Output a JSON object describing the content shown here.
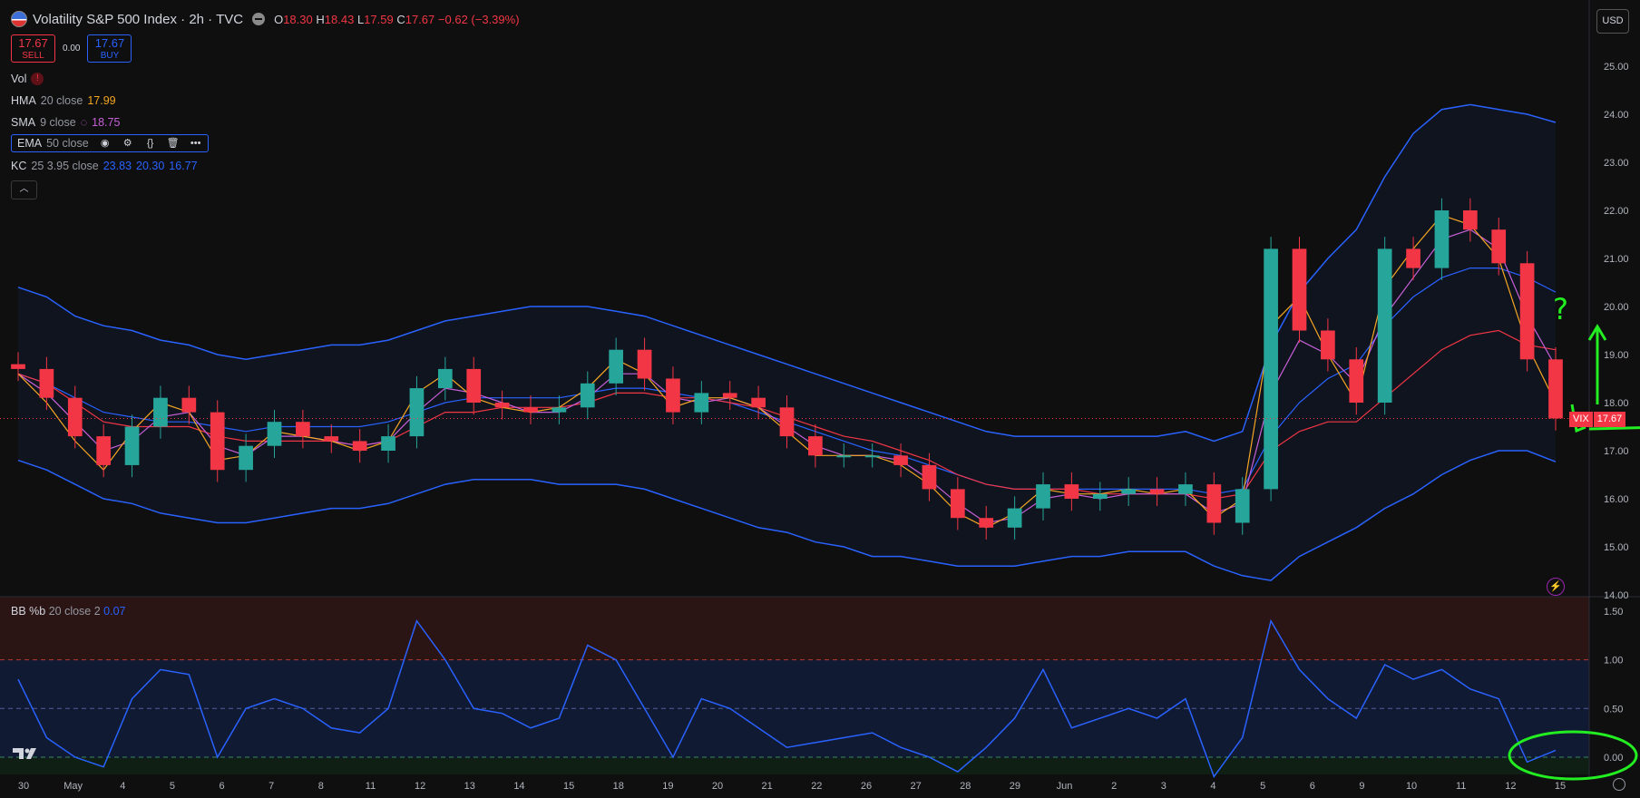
{
  "header": {
    "symbol": "Volatility S&P 500 Index · 2h · TVC",
    "open_label": "O",
    "open": "18.30",
    "high_label": "H",
    "high": "18.43",
    "low_label": "L",
    "low": "17.59",
    "close_label": "C",
    "close": "17.67",
    "change": "−0.62 (−3.39%)"
  },
  "trade": {
    "sell_price": "17.67",
    "sell_label": "SELL",
    "spread": "0.00",
    "buy_price": "17.67",
    "buy_label": "BUY"
  },
  "indicators": {
    "vol": "Vol",
    "hma": {
      "name": "HMA",
      "params": "20 close",
      "value": "17.99"
    },
    "sma": {
      "name": "SMA",
      "params": "9 close",
      "value": "18.75"
    },
    "ema": {
      "name": "EMA",
      "params": "50 close"
    },
    "kc": {
      "name": "KC",
      "params": "25 3.95 close",
      "v1": "23.83",
      "v2": "20.30",
      "v3": "16.77"
    }
  },
  "currency": "USD",
  "price_label": {
    "ticker": "VIX",
    "value": "17.67"
  },
  "bb": {
    "name": "BB %b",
    "params": "20 close 2",
    "value": "0.07"
  },
  "colors": {
    "up": "#26a69a",
    "down": "#f23645",
    "hma": "#f5a623",
    "sma": "#c760d8",
    "ema": "#f23645",
    "kc": "#2962ff",
    "bb": "#2962ff",
    "annotation": "#22ee22"
  },
  "chart_data": {
    "type": "candlestick",
    "y_axis_price": [
      "25.00",
      "24.00",
      "23.00",
      "22.00",
      "21.00",
      "20.00",
      "19.00",
      "18.00",
      "17.00",
      "16.00",
      "15.00",
      "14.00"
    ],
    "y_axis_bb": [
      "1.50",
      "1.00",
      "0.50",
      "0.00"
    ],
    "x_axis": [
      "30",
      "May",
      "4",
      "5",
      "6",
      "7",
      "8",
      "11",
      "12",
      "13",
      "14",
      "15",
      "18",
      "19",
      "20",
      "21",
      "22",
      "26",
      "27",
      "28",
      "29",
      "Jun",
      "2",
      "3",
      "4",
      "5",
      "6",
      "9",
      "10",
      "11",
      "12",
      "15"
    ],
    "closes": [
      18.7,
      18.1,
      17.3,
      16.7,
      17.5,
      18.1,
      17.8,
      16.6,
      17.1,
      17.6,
      17.3,
      17.2,
      17.0,
      17.3,
      18.3,
      18.7,
      18.0,
      17.9,
      17.8,
      17.9,
      18.4,
      19.1,
      18.5,
      17.8,
      18.2,
      18.1,
      17.9,
      17.3,
      16.9,
      16.9,
      16.9,
      16.7,
      16.2,
      15.6,
      15.4,
      15.8,
      16.3,
      16.0,
      16.1,
      16.2,
      16.1,
      16.3,
      15.5,
      16.2,
      21.2,
      19.5,
      18.9,
      18.0,
      21.2,
      20.8,
      22.0,
      21.6,
      20.9,
      18.9,
      17.67
    ],
    "hma": [
      18.6,
      18.0,
      17.2,
      16.6,
      17.4,
      18.0,
      17.8,
      16.8,
      16.9,
      17.4,
      17.3,
      17.2,
      17.0,
      17.2,
      18.2,
      18.6,
      18.1,
      17.9,
      17.8,
      17.9,
      18.3,
      18.9,
      18.6,
      17.9,
      18.1,
      18.1,
      17.9,
      17.4,
      16.9,
      16.9,
      16.9,
      16.7,
      16.3,
      15.7,
      15.4,
      15.7,
      16.2,
      16.1,
      16.1,
      16.2,
      16.1,
      16.2,
      15.6,
      16.0,
      19.6,
      20.2,
      19.0,
      18.0,
      20.4,
      21.2,
      21.9,
      21.7,
      21.0,
      19.2,
      17.99
    ],
    "sma": [
      18.6,
      18.2,
      17.6,
      17.0,
      17.2,
      17.7,
      17.8,
      17.1,
      16.9,
      17.3,
      17.3,
      17.2,
      17.1,
      17.2,
      17.8,
      18.3,
      18.2,
      18.0,
      17.8,
      17.8,
      18.1,
      18.6,
      18.6,
      18.1,
      18.0,
      18.1,
      17.9,
      17.5,
      17.1,
      16.9,
      16.9,
      16.8,
      16.4,
      15.9,
      15.5,
      15.6,
      16.0,
      16.1,
      16.0,
      16.1,
      16.1,
      16.1,
      15.7,
      15.9,
      18.2,
      19.3,
      19.0,
      18.4,
      19.8,
      20.6,
      21.4,
      21.6,
      21.2,
      19.8,
      18.75
    ],
    "ema": [
      18.6,
      18.4,
      18.0,
      17.6,
      17.5,
      17.5,
      17.5,
      17.3,
      17.2,
      17.2,
      17.2,
      17.2,
      17.1,
      17.2,
      17.5,
      17.8,
      17.8,
      17.9,
      17.9,
      17.9,
      18.0,
      18.2,
      18.2,
      18.1,
      18.1,
      18.0,
      17.9,
      17.7,
      17.5,
      17.3,
      17.2,
      17.0,
      16.8,
      16.5,
      16.3,
      16.2,
      16.2,
      16.2,
      16.1,
      16.1,
      16.1,
      16.1,
      16.0,
      16.1,
      17.0,
      17.4,
      17.6,
      17.6,
      18.1,
      18.6,
      19.1,
      19.4,
      19.5,
      19.2,
      19.1
    ],
    "kc_upper": [
      20.4,
      20.2,
      19.8,
      19.6,
      19.5,
      19.3,
      19.2,
      19.0,
      18.9,
      19.0,
      19.1,
      19.2,
      19.2,
      19.3,
      19.5,
      19.7,
      19.8,
      19.9,
      20.0,
      20.0,
      20.0,
      19.9,
      19.8,
      19.6,
      19.4,
      19.2,
      19.0,
      18.8,
      18.6,
      18.4,
      18.2,
      18.0,
      17.8,
      17.6,
      17.4,
      17.3,
      17.3,
      17.3,
      17.3,
      17.3,
      17.3,
      17.4,
      17.2,
      17.4,
      19.2,
      20.3,
      21.0,
      21.6,
      22.7,
      23.6,
      24.1,
      24.2,
      24.1,
      24.0,
      23.83
    ],
    "kc_mid": [
      18.6,
      18.4,
      18.1,
      17.8,
      17.7,
      17.6,
      17.6,
      17.5,
      17.4,
      17.5,
      17.5,
      17.5,
      17.5,
      17.6,
      17.8,
      18.0,
      18.1,
      18.1,
      18.1,
      18.1,
      18.2,
      18.3,
      18.3,
      18.2,
      18.1,
      18.0,
      17.8,
      17.6,
      17.4,
      17.2,
      17.0,
      16.9,
      16.7,
      16.5,
      16.3,
      16.2,
      16.2,
      16.2,
      16.2,
      16.2,
      16.2,
      16.2,
      16.1,
      16.2,
      17.3,
      18.0,
      18.5,
      18.8,
      19.6,
      20.2,
      20.6,
      20.8,
      20.8,
      20.6,
      20.3
    ],
    "kc_lower": [
      16.8,
      16.6,
      16.3,
      16.0,
      15.9,
      15.7,
      15.6,
      15.5,
      15.5,
      15.6,
      15.7,
      15.8,
      15.8,
      15.9,
      16.1,
      16.3,
      16.4,
      16.4,
      16.4,
      16.3,
      16.3,
      16.3,
      16.2,
      16.0,
      15.8,
      15.6,
      15.4,
      15.3,
      15.1,
      15.0,
      14.8,
      14.8,
      14.7,
      14.6,
      14.6,
      14.6,
      14.7,
      14.8,
      14.8,
      14.9,
      14.9,
      14.9,
      14.6,
      14.4,
      14.3,
      14.8,
      15.1,
      15.4,
      15.8,
      16.1,
      16.5,
      16.8,
      17.0,
      17.0,
      16.77
    ],
    "bb_pct_b": [
      0.8,
      0.2,
      0.0,
      -0.1,
      0.6,
      0.9,
      0.85,
      0.0,
      0.5,
      0.6,
      0.5,
      0.3,
      0.25,
      0.5,
      1.4,
      1.0,
      0.5,
      0.45,
      0.3,
      0.4,
      1.15,
      1.0,
      0.5,
      0.0,
      0.6,
      0.5,
      0.3,
      0.1,
      0.15,
      0.2,
      0.25,
      0.1,
      0.0,
      -0.15,
      0.1,
      0.4,
      0.9,
      0.3,
      0.4,
      0.5,
      0.4,
      0.6,
      -0.2,
      0.2,
      1.4,
      0.9,
      0.6,
      0.4,
      0.95,
      0.8,
      0.9,
      0.7,
      0.6,
      -0.05,
      0.07
    ],
    "annotations": [
      "?"
    ]
  }
}
